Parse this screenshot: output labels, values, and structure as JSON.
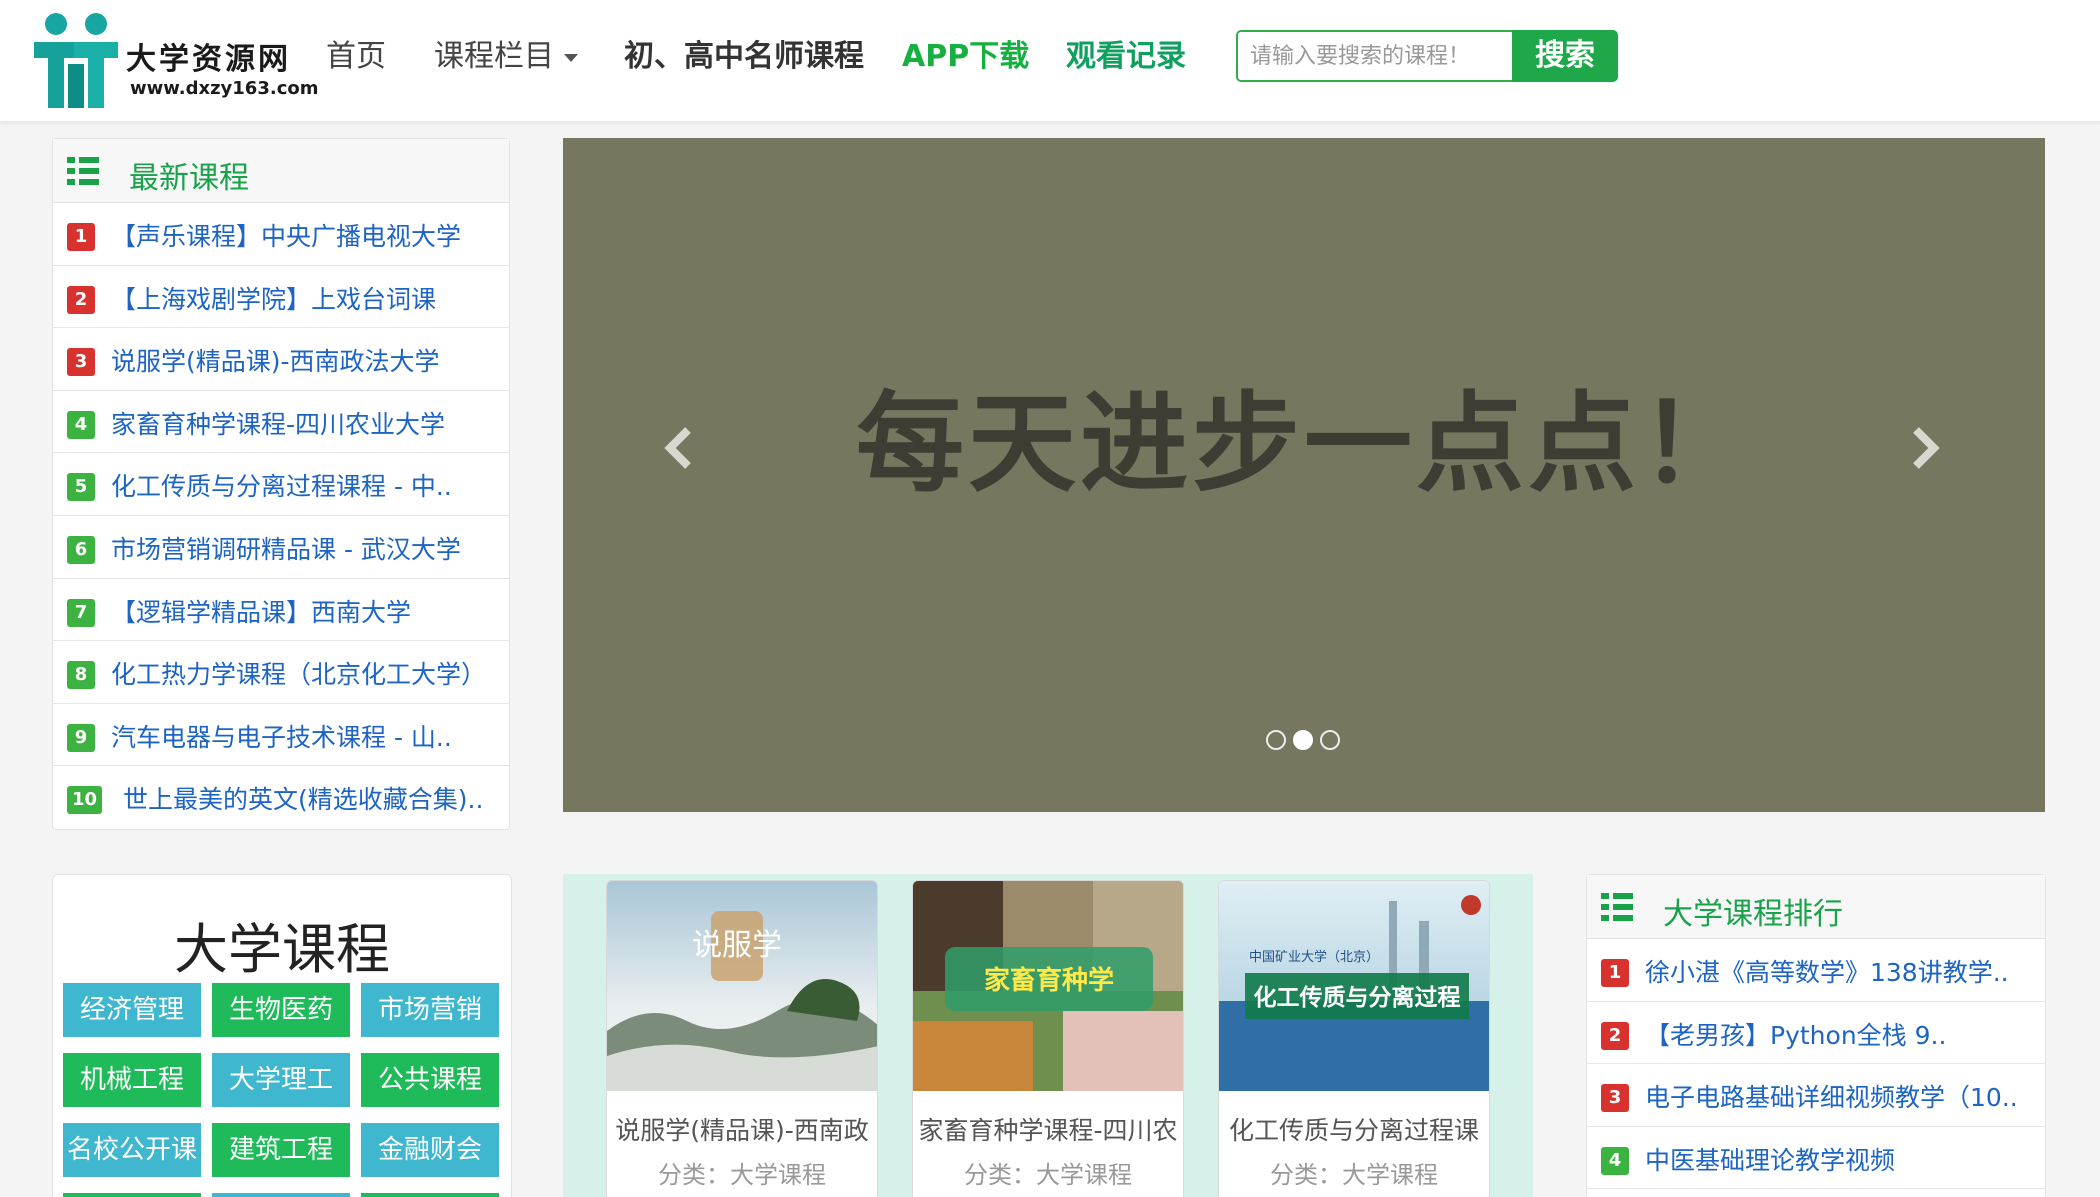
{
  "header": {
    "logo_name": "大学资源网",
    "logo_url": "www.dxzy163.com",
    "nav": {
      "home": "首页",
      "columns": "课程栏目",
      "teachers": "初、高中名师课程",
      "app": "APP下载",
      "history": "观看记录"
    },
    "search": {
      "placeholder": "请输入要搜索的课程！",
      "button": "搜索"
    }
  },
  "latest": {
    "title": "最新课程",
    "items": [
      {
        "num": "1",
        "text": "【声乐课程】中央广播电视大学"
      },
      {
        "num": "2",
        "text": "【上海戏剧学院】上戏台词课"
      },
      {
        "num": "3",
        "text": "说服学(精品课)-西南政法大学"
      },
      {
        "num": "4",
        "text": "家畜育种学课程-四川农业大学"
      },
      {
        "num": "5",
        "text": "化工传质与分离过程课程 - 中.."
      },
      {
        "num": "6",
        "text": "市场营销调研精品课 - 武汉大学"
      },
      {
        "num": "7",
        "text": "【逻辑学精品课】西南大学"
      },
      {
        "num": "8",
        "text": "化工热力学课程（北京化工大学）"
      },
      {
        "num": "9",
        "text": "汽车电器与电子技术课程 - 山.."
      },
      {
        "num": "10",
        "text": "世上最美的英文(精选收藏合集).."
      }
    ]
  },
  "carousel": {
    "slide_text": "每天进步一点点！",
    "active_index": 1,
    "slide_count": 3
  },
  "categories": {
    "title": "大学课程",
    "tags": [
      "经济管理",
      "生物医药",
      "市场营销",
      "机械工程",
      "大学理工",
      "公共课程",
      "名校公开课",
      "建筑工程",
      "金融财会"
    ]
  },
  "courses": [
    {
      "title": "说服学(精品课)-西南政",
      "category": "分类：大学课程",
      "image_text": "说服学"
    },
    {
      "title": "家畜育种学课程-四川农",
      "category": "分类：大学课程",
      "image_text": "家畜育种学"
    },
    {
      "title": "化工传质与分离过程课",
      "category": "分类：大学课程",
      "image_text": "化工传质与分离过程",
      "image_sub": "中国矿业大学（北京）"
    }
  ],
  "ranking": {
    "title": "大学课程排行",
    "items": [
      {
        "num": "1",
        "text": "徐小湛《高等数学》138讲教学.."
      },
      {
        "num": "2",
        "text": "【老男孩】Python全栈 9.."
      },
      {
        "num": "3",
        "text": "电子电路基础详细视频教学（10.."
      },
      {
        "num": "4",
        "text": "中医基础理论教学视频"
      }
    ]
  },
  "colors": {
    "accent_green": "#1fa84a",
    "rank_red": "#d8322e",
    "rank_green": "#3cb341",
    "link_blue": "#1d64c4",
    "carousel_bg": "#77765f"
  }
}
